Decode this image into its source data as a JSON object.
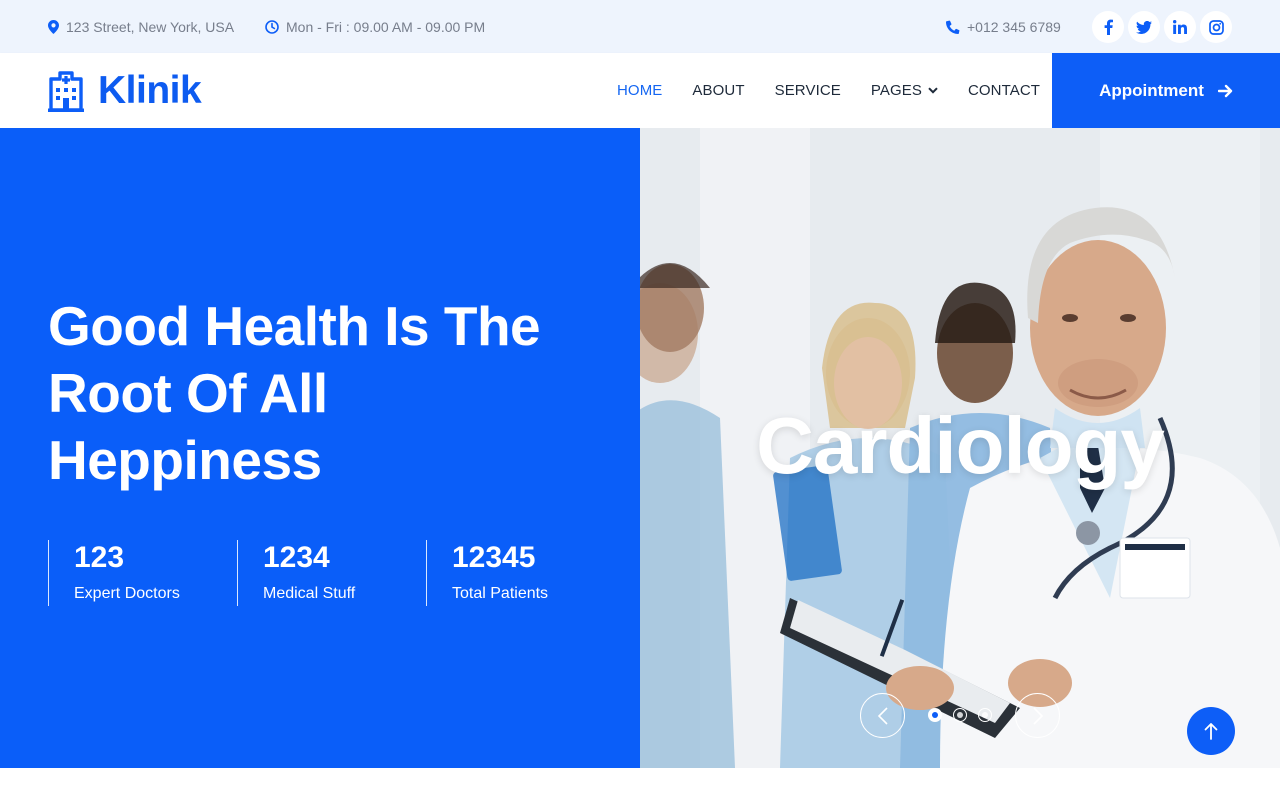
{
  "topbar": {
    "address": "123 Street, New York, USA",
    "hours": "Mon - Fri : 09.00 AM - 09.00 PM",
    "phone": "+012 345 6789",
    "social_icons": [
      "facebook-icon",
      "twitter-icon",
      "linkedin-icon",
      "instagram-icon"
    ]
  },
  "brand": {
    "name": "Klinik",
    "icon": "hospital-icon"
  },
  "nav": {
    "items": [
      {
        "label": "HOME",
        "active": true
      },
      {
        "label": "ABOUT",
        "active": false
      },
      {
        "label": "SERVICE",
        "active": false
      },
      {
        "label": "PAGES",
        "active": false,
        "dropdown": true
      },
      {
        "label": "CONTACT",
        "active": false
      }
    ],
    "appointment_label": "Appointment"
  },
  "hero": {
    "title": "Good Health Is The Root Of All Heppiness",
    "stats": [
      {
        "value": "123",
        "label": "Expert Doctors"
      },
      {
        "value": "1234",
        "label": "Medical Stuff"
      },
      {
        "value": "12345",
        "label": "Total Patients"
      }
    ]
  },
  "carousel": {
    "slide_title": "Cardiology",
    "slide_count": 3,
    "active_slide": 1
  },
  "colors": {
    "primary": "#0d5ef7",
    "topbar_bg": "#eef4fd",
    "nav_text": "#1e2a3a",
    "muted_text": "#777e8c"
  }
}
